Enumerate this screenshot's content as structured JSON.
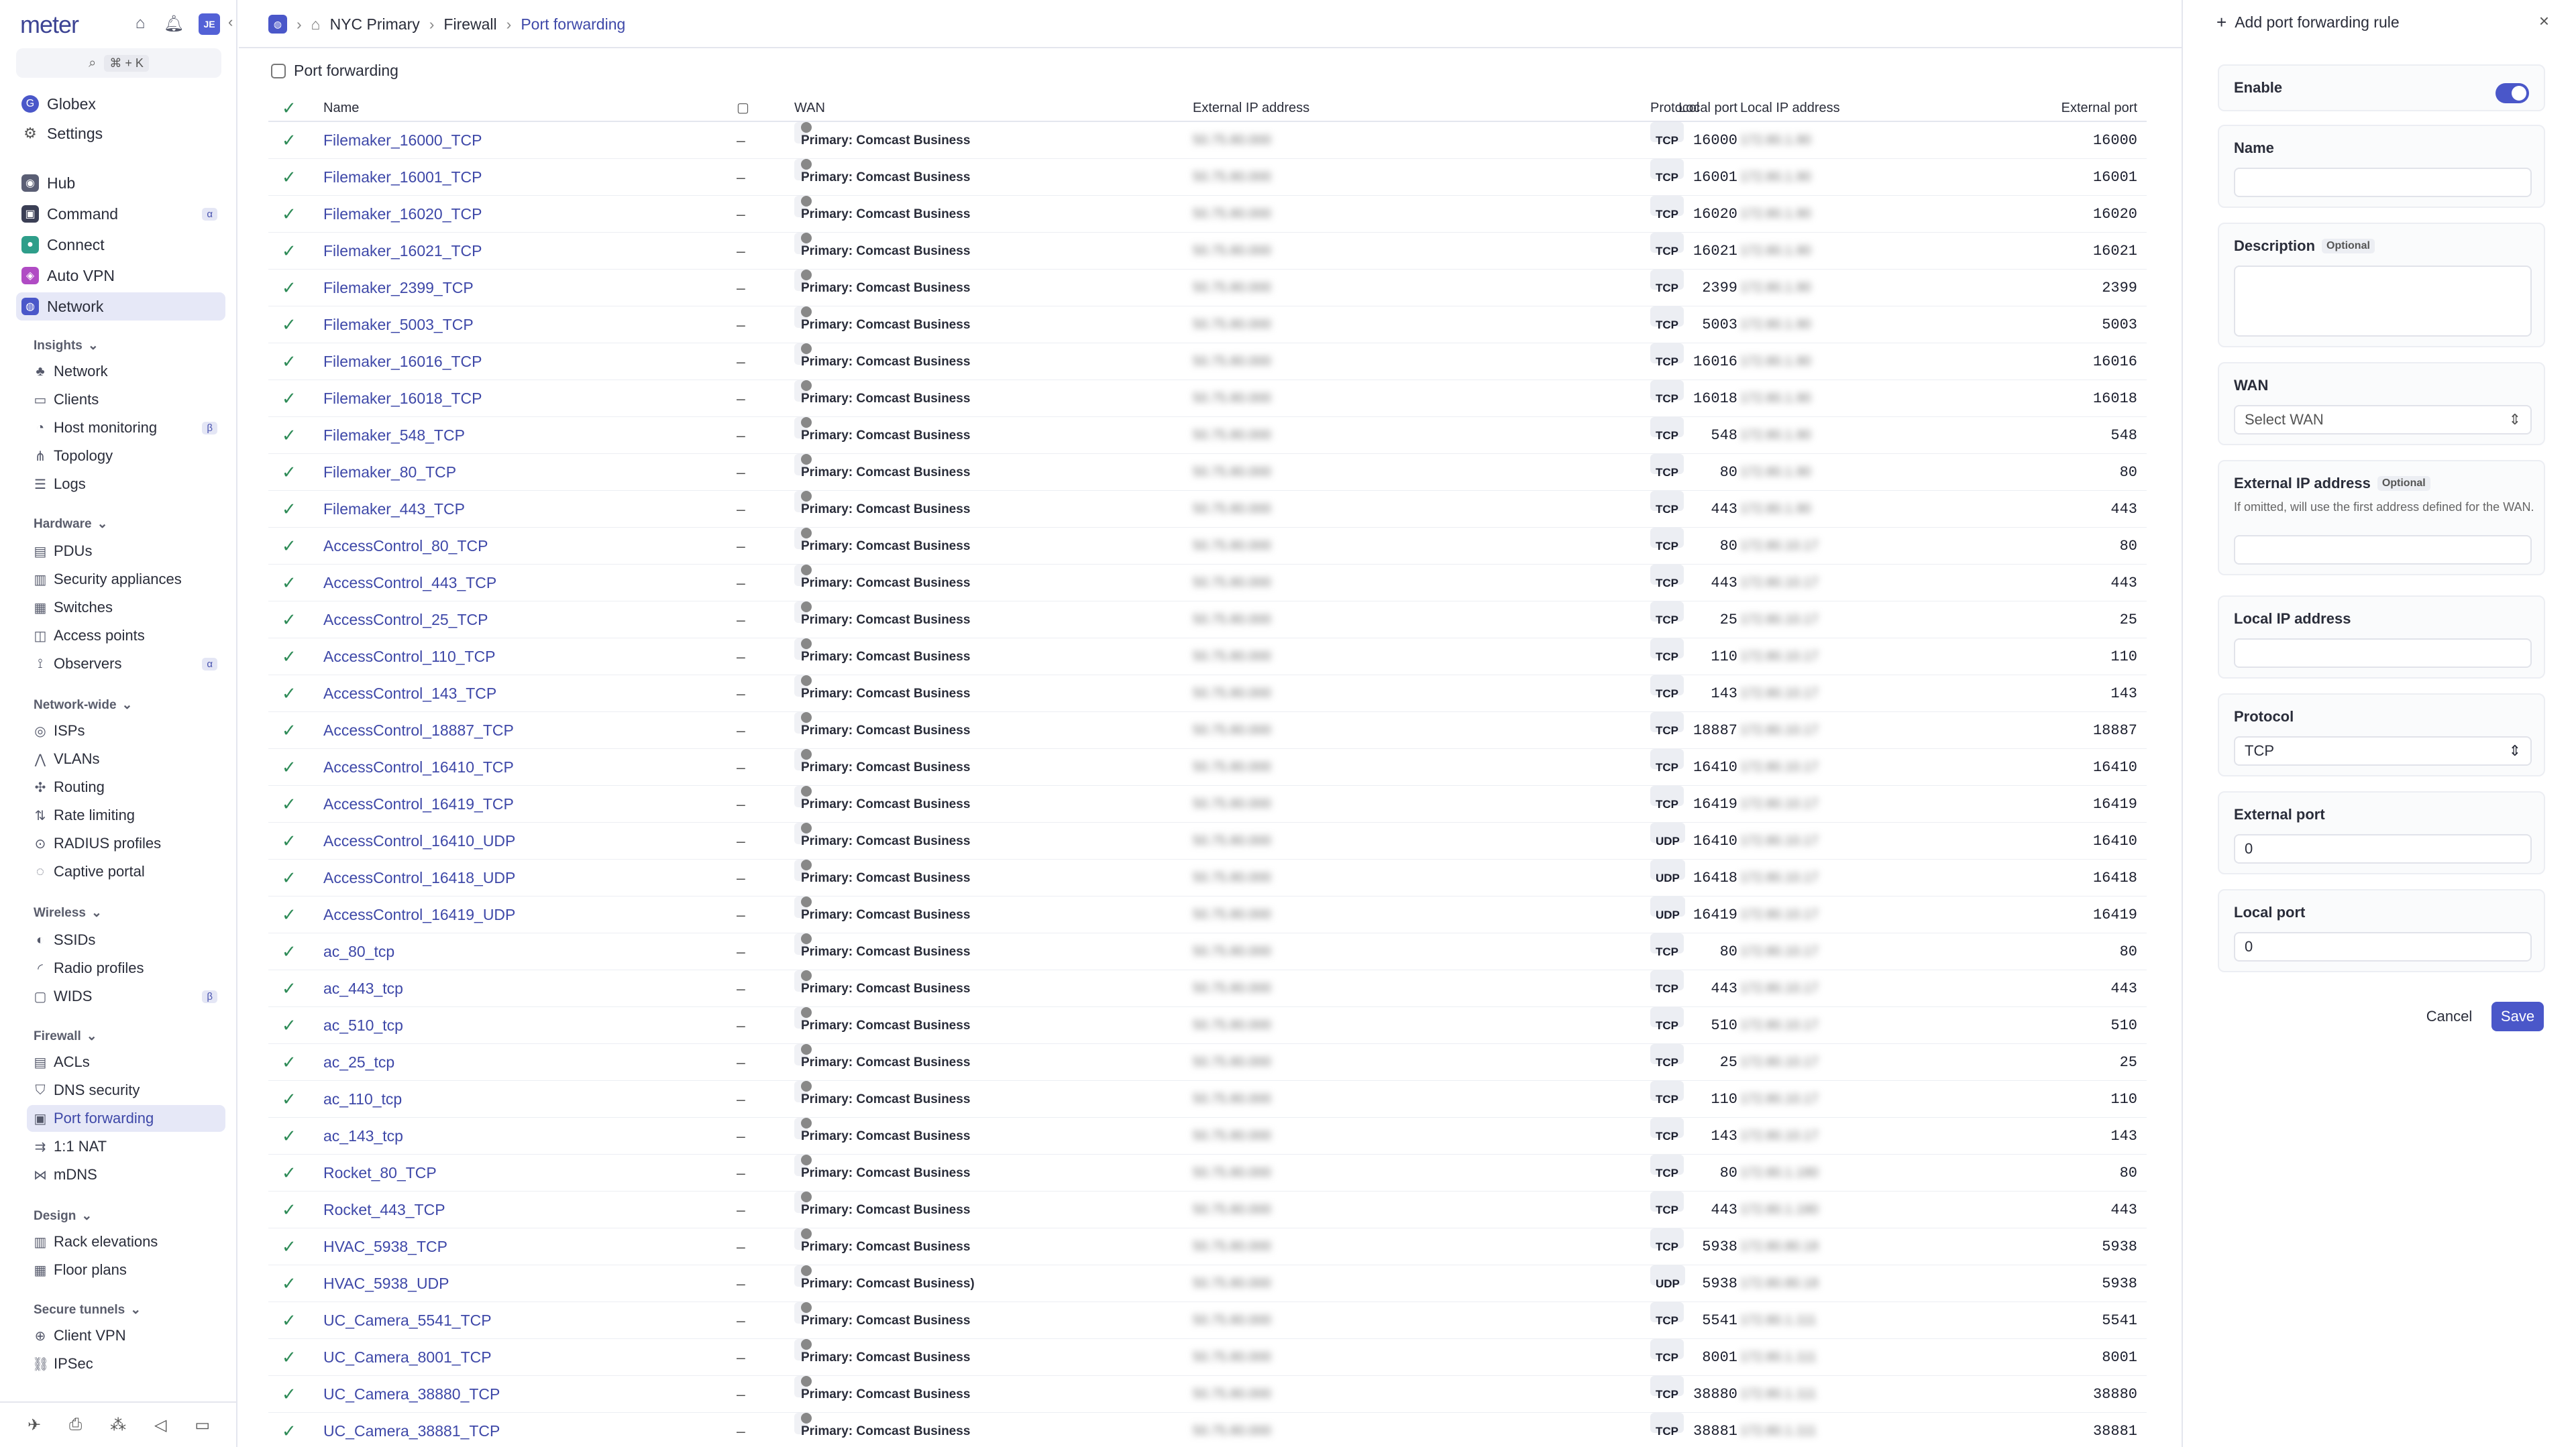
{
  "app": {
    "logo": "meter",
    "user_initials": "JE",
    "search_shortcut": "⌘ + K"
  },
  "sidebar": {
    "org": "Globex",
    "settings": "Settings",
    "top_nav": [
      {
        "label": "Hub",
        "badge": ""
      },
      {
        "label": "Command",
        "badge": "α"
      },
      {
        "label": "Connect",
        "badge": ""
      },
      {
        "label": "Auto VPN",
        "badge": ""
      },
      {
        "label": "Network",
        "badge": ""
      }
    ],
    "groups": {
      "insights": {
        "label": "Insights",
        "items": [
          {
            "label": "Network",
            "badge": ""
          },
          {
            "label": "Clients",
            "badge": ""
          },
          {
            "label": "Host monitoring",
            "badge": "β"
          },
          {
            "label": "Topology",
            "badge": ""
          },
          {
            "label": "Logs",
            "badge": ""
          }
        ]
      },
      "hardware": {
        "label": "Hardware",
        "items": [
          {
            "label": "PDUs",
            "badge": ""
          },
          {
            "label": "Security appliances",
            "badge": ""
          },
          {
            "label": "Switches",
            "badge": ""
          },
          {
            "label": "Access points",
            "badge": ""
          },
          {
            "label": "Observers",
            "badge": "α"
          }
        ]
      },
      "network_wide": {
        "label": "Network-wide",
        "items": [
          {
            "label": "ISPs",
            "badge": ""
          },
          {
            "label": "VLANs",
            "badge": ""
          },
          {
            "label": "Routing",
            "badge": ""
          },
          {
            "label": "Rate limiting",
            "badge": ""
          },
          {
            "label": "RADIUS profiles",
            "badge": ""
          },
          {
            "label": "Captive portal",
            "badge": ""
          }
        ]
      },
      "wireless": {
        "label": "Wireless",
        "items": [
          {
            "label": "SSIDs",
            "badge": ""
          },
          {
            "label": "Radio profiles",
            "badge": ""
          },
          {
            "label": "WIDS",
            "badge": "β"
          }
        ]
      },
      "firewall": {
        "label": "Firewall",
        "items": [
          {
            "label": "ACLs",
            "badge": ""
          },
          {
            "label": "DNS security",
            "badge": ""
          },
          {
            "label": "Port forwarding",
            "badge": ""
          },
          {
            "label": "1:1 NAT",
            "badge": ""
          },
          {
            "label": "mDNS",
            "badge": ""
          }
        ]
      },
      "design": {
        "label": "Design",
        "items": [
          {
            "label": "Rack elevations",
            "badge": ""
          },
          {
            "label": "Floor plans",
            "badge": ""
          }
        ]
      },
      "secure_tunnels": {
        "label": "Secure tunnels",
        "items": [
          {
            "label": "Client VPN",
            "badge": ""
          },
          {
            "label": "IPSec",
            "badge": ""
          }
        ]
      }
    }
  },
  "breadcrumb": {
    "network": "NYC Primary",
    "section": "Firewall",
    "current": "Port forwarding"
  },
  "page_title": "Port forwarding",
  "table": {
    "headers": {
      "name": "Name",
      "wan": "WAN",
      "external_ip": "External IP address",
      "local_port": "Local port",
      "protocol": "Protocol",
      "local_ip": "Local IP address",
      "external_port": "External port"
    },
    "rows": [
      {
        "name": "Filemaker_16000_TCP",
        "icon": "–",
        "wan": "Primary: Comcast Business",
        "external_ip": "50.75.80.000",
        "local_port": "16000",
        "protocol": "TCP",
        "local_ip": "172.80.1.90",
        "external_port": "16000"
      },
      {
        "name": "Filemaker_16001_TCP",
        "icon": "–",
        "wan": "Primary: Comcast Business",
        "external_ip": "50.75.80.000",
        "local_port": "16001",
        "protocol": "TCP",
        "local_ip": "172.80.1.90",
        "external_port": "16001"
      },
      {
        "name": "Filemaker_16020_TCP",
        "icon": "–",
        "wan": "Primary: Comcast Business",
        "external_ip": "50.75.80.000",
        "local_port": "16020",
        "protocol": "TCP",
        "local_ip": "172.80.1.90",
        "external_port": "16020"
      },
      {
        "name": "Filemaker_16021_TCP",
        "icon": "–",
        "wan": "Primary: Comcast Business",
        "external_ip": "50.75.80.000",
        "local_port": "16021",
        "protocol": "TCP",
        "local_ip": "172.80.1.90",
        "external_port": "16021"
      },
      {
        "name": "Filemaker_2399_TCP",
        "icon": "–",
        "wan": "Primary: Comcast Business",
        "external_ip": "50.75.80.000",
        "local_port": "2399",
        "protocol": "TCP",
        "local_ip": "172.80.1.90",
        "external_port": "2399"
      },
      {
        "name": "Filemaker_5003_TCP",
        "icon": "–",
        "wan": "Primary: Comcast Business",
        "external_ip": "50.75.80.000",
        "local_port": "5003",
        "protocol": "TCP",
        "local_ip": "172.80.1.90",
        "external_port": "5003"
      },
      {
        "name": "Filemaker_16016_TCP",
        "icon": "–",
        "wan": "Primary: Comcast Business",
        "external_ip": "50.75.80.000",
        "local_port": "16016",
        "protocol": "TCP",
        "local_ip": "172.80.1.90",
        "external_port": "16016"
      },
      {
        "name": "Filemaker_16018_TCP",
        "icon": "–",
        "wan": "Primary: Comcast Business",
        "external_ip": "50.75.80.000",
        "local_port": "16018",
        "protocol": "TCP",
        "local_ip": "172.80.1.90",
        "external_port": "16018"
      },
      {
        "name": "Filemaker_548_TCP",
        "icon": "–",
        "wan": "Primary: Comcast Business",
        "external_ip": "50.75.80.000",
        "local_port": "548",
        "protocol": "TCP",
        "local_ip": "172.80.1.90",
        "external_port": "548"
      },
      {
        "name": "Filemaker_80_TCP",
        "icon": "–",
        "wan": "Primary: Comcast Business",
        "external_ip": "50.75.80.000",
        "local_port": "80",
        "protocol": "TCP",
        "local_ip": "172.80.1.90",
        "external_port": "80"
      },
      {
        "name": "Filemaker_443_TCP",
        "icon": "–",
        "wan": "Primary: Comcast Business",
        "external_ip": "50.75.80.000",
        "local_port": "443",
        "protocol": "TCP",
        "local_ip": "172.80.1.90",
        "external_port": "443"
      },
      {
        "name": "AccessControl_80_TCP",
        "icon": "–",
        "wan": "Primary: Comcast Business",
        "external_ip": "50.75.80.000",
        "local_port": "80",
        "protocol": "TCP",
        "local_ip": "172.80.10.17",
        "external_port": "80"
      },
      {
        "name": "AccessControl_443_TCP",
        "icon": "–",
        "wan": "Primary: Comcast Business",
        "external_ip": "50.75.80.000",
        "local_port": "443",
        "protocol": "TCP",
        "local_ip": "172.80.10.17",
        "external_port": "443"
      },
      {
        "name": "AccessControl_25_TCP",
        "icon": "–",
        "wan": "Primary: Comcast Business",
        "external_ip": "50.75.80.000",
        "local_port": "25",
        "protocol": "TCP",
        "local_ip": "172.80.10.17",
        "external_port": "25"
      },
      {
        "name": "AccessControl_110_TCP",
        "icon": "–",
        "wan": "Primary: Comcast Business",
        "external_ip": "50.75.80.000",
        "local_port": "110",
        "protocol": "TCP",
        "local_ip": "172.80.10.17",
        "external_port": "110"
      },
      {
        "name": "AccessControl_143_TCP",
        "icon": "–",
        "wan": "Primary: Comcast Business",
        "external_ip": "50.75.80.000",
        "local_port": "143",
        "protocol": "TCP",
        "local_ip": "172.80.10.17",
        "external_port": "143"
      },
      {
        "name": "AccessControl_18887_TCP",
        "icon": "–",
        "wan": "Primary: Comcast Business",
        "external_ip": "50.75.80.000",
        "local_port": "18887",
        "protocol": "TCP",
        "local_ip": "172.80.10.17",
        "external_port": "18887"
      },
      {
        "name": "AccessControl_16410_TCP",
        "icon": "–",
        "wan": "Primary: Comcast Business",
        "external_ip": "50.75.80.000",
        "local_port": "16410",
        "protocol": "TCP",
        "local_ip": "172.80.10.17",
        "external_port": "16410"
      },
      {
        "name": "AccessControl_16419_TCP",
        "icon": "–",
        "wan": "Primary: Comcast Business",
        "external_ip": "50.75.80.000",
        "local_port": "16419",
        "protocol": "TCP",
        "local_ip": "172.80.10.17",
        "external_port": "16419"
      },
      {
        "name": "AccessControl_16410_UDP",
        "icon": "–",
        "wan": "Primary: Comcast Business",
        "external_ip": "50.75.80.000",
        "local_port": "16410",
        "protocol": "UDP",
        "local_ip": "172.80.10.17",
        "external_port": "16410"
      },
      {
        "name": "AccessControl_16418_UDP",
        "icon": "–",
        "wan": "Primary: Comcast Business",
        "external_ip": "50.75.80.000",
        "local_port": "16418",
        "protocol": "UDP",
        "local_ip": "172.80.10.17",
        "external_port": "16418"
      },
      {
        "name": "AccessControl_16419_UDP",
        "icon": "–",
        "wan": "Primary: Comcast Business",
        "external_ip": "50.75.80.000",
        "local_port": "16419",
        "protocol": "UDP",
        "local_ip": "172.80.10.17",
        "external_port": "16419"
      },
      {
        "name": "ac_80_tcp",
        "icon": "–",
        "wan": "Primary: Comcast Business",
        "external_ip": "50.75.80.000",
        "local_port": "80",
        "protocol": "TCP",
        "local_ip": "172.80.10.17",
        "external_port": "80"
      },
      {
        "name": "ac_443_tcp",
        "icon": "–",
        "wan": "Primary: Comcast Business",
        "external_ip": "50.75.80.000",
        "local_port": "443",
        "protocol": "TCP",
        "local_ip": "172.80.10.17",
        "external_port": "443"
      },
      {
        "name": "ac_510_tcp",
        "icon": "–",
        "wan": "Primary: Comcast Business",
        "external_ip": "50.75.80.000",
        "local_port": "510",
        "protocol": "TCP",
        "local_ip": "172.80.10.17",
        "external_port": "510"
      },
      {
        "name": "ac_25_tcp",
        "icon": "–",
        "wan": "Primary: Comcast Business",
        "external_ip": "50.75.80.000",
        "local_port": "25",
        "protocol": "TCP",
        "local_ip": "172.80.10.17",
        "external_port": "25"
      },
      {
        "name": "ac_110_tcp",
        "icon": "–",
        "wan": "Primary: Comcast Business",
        "external_ip": "50.75.80.000",
        "local_port": "110",
        "protocol": "TCP",
        "local_ip": "172.80.10.17",
        "external_port": "110"
      },
      {
        "name": "ac_143_tcp",
        "icon": "–",
        "wan": "Primary: Comcast Business",
        "external_ip": "50.75.80.000",
        "local_port": "143",
        "protocol": "TCP",
        "local_ip": "172.80.10.17",
        "external_port": "143"
      },
      {
        "name": "Rocket_80_TCP",
        "icon": "–",
        "wan": "Primary: Comcast Business",
        "external_ip": "50.75.80.000",
        "local_port": "80",
        "protocol": "TCP",
        "local_ip": "172.80.1.180",
        "external_port": "80"
      },
      {
        "name": "Rocket_443_TCP",
        "icon": "–",
        "wan": "Primary: Comcast Business",
        "external_ip": "50.75.80.000",
        "local_port": "443",
        "protocol": "TCP",
        "local_ip": "172.80.1.180",
        "external_port": "443"
      },
      {
        "name": "HVAC_5938_TCP",
        "icon": "–",
        "wan": "Primary: Comcast Business",
        "external_ip": "50.75.80.000",
        "local_port": "5938",
        "protocol": "TCP",
        "local_ip": "172.80.80.18",
        "external_port": "5938"
      },
      {
        "name": "HVAC_5938_UDP",
        "icon": "–",
        "wan": "Primary: Comcast Business)",
        "external_ip": "50.75.80.000",
        "local_port": "5938",
        "protocol": "UDP",
        "local_ip": "172.80.80.18",
        "external_port": "5938"
      },
      {
        "name": "UC_Camera_5541_TCP",
        "icon": "–",
        "wan": "Primary: Comcast Business",
        "external_ip": "50.75.80.000",
        "local_port": "5541",
        "protocol": "TCP",
        "local_ip": "172.80.1.111",
        "external_port": "5541"
      },
      {
        "name": "UC_Camera_8001_TCP",
        "icon": "–",
        "wan": "Primary: Comcast Business",
        "external_ip": "50.75.80.000",
        "local_port": "8001",
        "protocol": "TCP",
        "local_ip": "172.80.1.111",
        "external_port": "8001"
      },
      {
        "name": "UC_Camera_38880_TCP",
        "icon": "–",
        "wan": "Primary: Comcast Business",
        "external_ip": "50.75.80.000",
        "local_port": "38880",
        "protocol": "TCP",
        "local_ip": "172.80.1.111",
        "external_port": "38880"
      },
      {
        "name": "UC_Camera_38881_TCP",
        "icon": "–",
        "wan": "Primary: Comcast Business",
        "external_ip": "50.75.80.000",
        "local_port": "38881",
        "protocol": "TCP",
        "local_ip": "172.80.1.111",
        "external_port": "38881"
      }
    ]
  },
  "panel": {
    "title": "Add port forwarding rule",
    "enable_label": "Enable",
    "enabled": true,
    "name_label": "Name",
    "name_value": "",
    "description_label": "Description",
    "optional": "Optional",
    "description_value": "",
    "wan_label": "WAN",
    "wan_placeholder": "Select WAN",
    "external_ip_label": "External IP address",
    "external_ip_help": "If omitted, will use the first address defined for the WAN.",
    "external_ip_value": "",
    "local_ip_label": "Local IP address",
    "local_ip_value": "",
    "protocol_label": "Protocol",
    "protocol_value": "TCP",
    "external_port_label": "External port",
    "external_port_value": "0",
    "local_port_label": "Local port",
    "local_port_value": "0",
    "cancel": "Cancel",
    "save": "Save"
  },
  "colors": {
    "accent": "#4a57c9",
    "link": "#3e48a8",
    "check": "#2e8b57"
  }
}
